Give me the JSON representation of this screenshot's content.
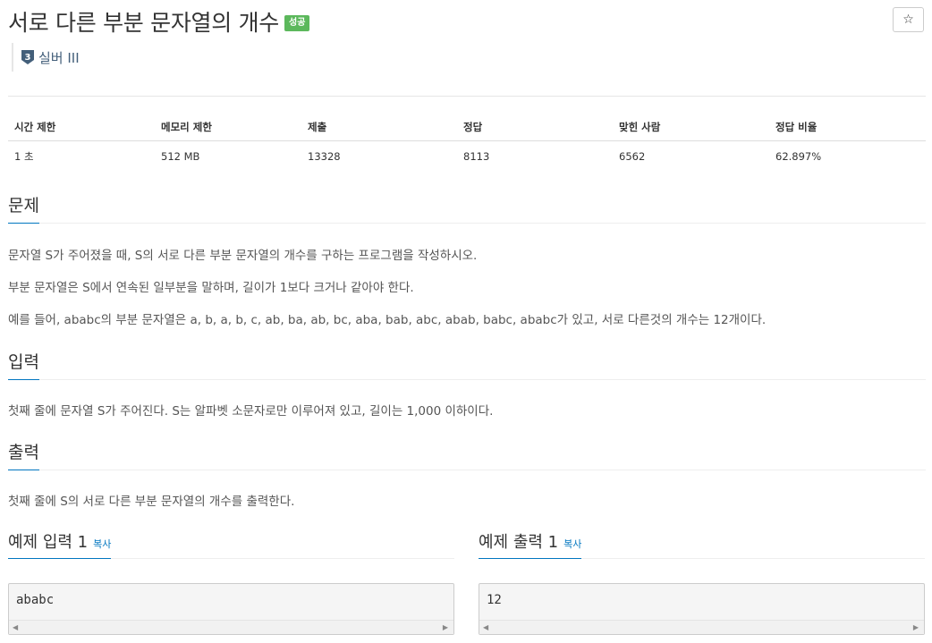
{
  "header": {
    "title": "서로 다른 부분 문자열의 개수",
    "badge": "성공",
    "star_icon": "☆"
  },
  "tier": {
    "icon": "silver-tier-badge",
    "level": "3",
    "name": "실버 III"
  },
  "info_table": {
    "headers": [
      "시간 제한",
      "메모리 제한",
      "제출",
      "정답",
      "맞힌 사람",
      "정답 비율"
    ],
    "values": [
      "1 초",
      "512 MB",
      "13328",
      "8113",
      "6562",
      "62.897%"
    ]
  },
  "problem": {
    "title": "문제",
    "paragraphs": [
      "문자열 S가 주어졌을 때, S의 서로 다른 부분 문자열의 개수를 구하는 프로그램을 작성하시오.",
      "부분 문자열은 S에서 연속된 일부분을 말하며, 길이가 1보다 크거나 같아야 한다.",
      "예를 들어, ababc의 부분 문자열은 a, b, a, b, c, ab, ba, ab, bc, aba, bab, abc, abab, babc, ababc가 있고, 서로 다른것의 개수는 12개이다."
    ]
  },
  "input": {
    "title": "입력",
    "text": "첫째 줄에 문자열 S가 주어진다. S는 알파벳 소문자로만 이루어져 있고, 길이는 1,000 이하이다."
  },
  "output": {
    "title": "출력",
    "text": "첫째 줄에 S의 서로 다른 부분 문자열의 개수를 출력한다."
  },
  "samples": {
    "input": {
      "title": "예제 입력 1",
      "copy": "복사",
      "content": "ababc"
    },
    "output": {
      "title": "예제 출력 1",
      "copy": "복사",
      "content": "12"
    }
  },
  "colors": {
    "accent": "#0076c0",
    "success": "#5cb85c",
    "tier_silver": "#435f7a"
  }
}
